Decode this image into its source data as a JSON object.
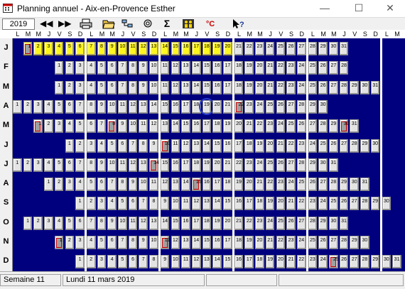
{
  "window": {
    "title": "Planning annuel - Aix-en-Provence Esther"
  },
  "toolbar": {
    "year": "2019"
  },
  "week_header": [
    "L",
    "M",
    "M",
    "J",
    "V",
    "S",
    "D",
    "L",
    "M",
    "M",
    "J",
    "V",
    "S",
    "D",
    "L",
    "M",
    "M",
    "J",
    "V",
    "S",
    "D",
    "L",
    "M",
    "M",
    "J",
    "V",
    "S",
    "D",
    "L",
    "M",
    "M",
    "J",
    "V",
    "S",
    "D",
    "L",
    "M"
  ],
  "months": [
    {
      "label": "J",
      "first_col": 1,
      "days": 31,
      "holidays": [
        1,
        2,
        3,
        4,
        5,
        6,
        7,
        8,
        9,
        10,
        11,
        12,
        13,
        14,
        15,
        16,
        17,
        18,
        19,
        20
      ],
      "marked": [
        1
      ]
    },
    {
      "label": "F",
      "first_col": 4,
      "days": 28,
      "holidays": [],
      "marked": []
    },
    {
      "label": "M",
      "first_col": 4,
      "days": 31,
      "holidays": [],
      "marked": []
    },
    {
      "label": "A",
      "first_col": 0,
      "days": 30,
      "holidays": [],
      "marked": [
        22
      ],
      "circled": 19
    },
    {
      "label": "M",
      "first_col": 2,
      "days": 31,
      "holidays": [],
      "marked": [
        1,
        8,
        30
      ]
    },
    {
      "label": "J",
      "first_col": 5,
      "days": 30,
      "holidays": [],
      "marked": [
        10
      ]
    },
    {
      "label": "J",
      "first_col": 0,
      "days": 31,
      "holidays": [],
      "marked": [
        14
      ]
    },
    {
      "label": "A",
      "first_col": 3,
      "days": 31,
      "holidays": [],
      "marked": [
        15
      ]
    },
    {
      "label": "S",
      "first_col": 6,
      "days": 30,
      "holidays": [],
      "marked": []
    },
    {
      "label": "O",
      "first_col": 1,
      "days": 31,
      "holidays": [],
      "marked": []
    },
    {
      "label": "N",
      "first_col": 4,
      "days": 30,
      "holidays": [],
      "marked": [
        1,
        11
      ]
    },
    {
      "label": "D",
      "first_col": 6,
      "days": 31,
      "holidays": [],
      "marked": [
        25
      ]
    }
  ],
  "status": {
    "week": "Semaine 11",
    "date": "Lundi 11 mars 2019"
  }
}
